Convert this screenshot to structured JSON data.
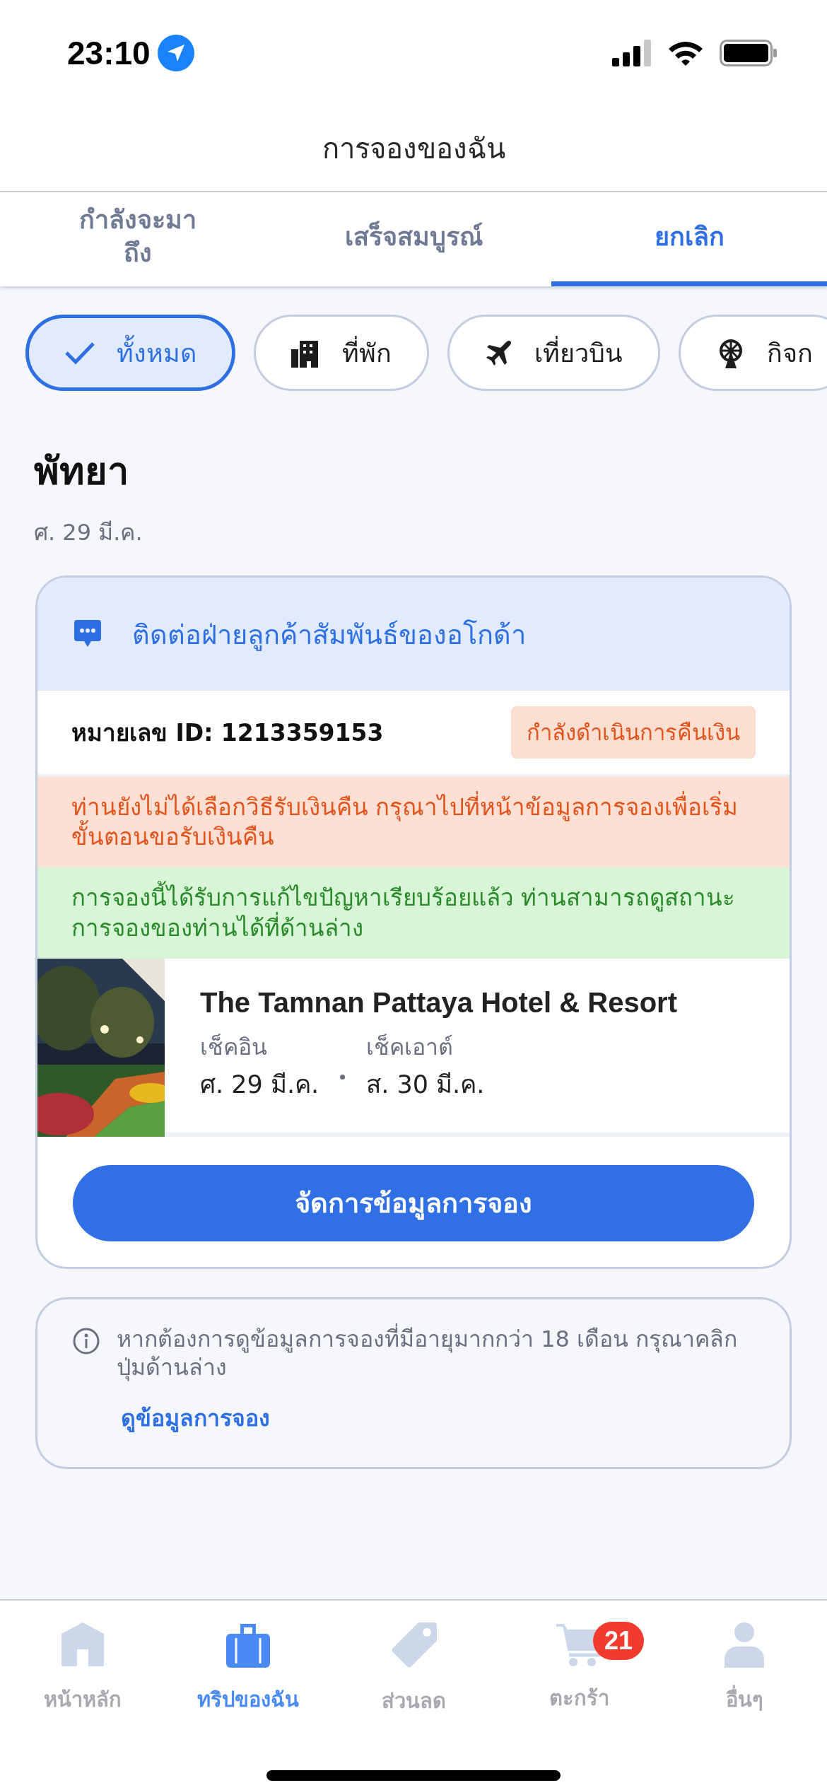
{
  "status_bar": {
    "time": "23:10"
  },
  "header": {
    "title": "การจองของฉัน"
  },
  "tabs": [
    {
      "label": "กำลังจะมาถึง",
      "selected": false
    },
    {
      "label": "เสร็จสมบูรณ์",
      "selected": false
    },
    {
      "label": "ยกเลิก",
      "selected": true
    }
  ],
  "filters": [
    {
      "label": "ทั้งหมด",
      "kind": "all",
      "selected": true
    },
    {
      "label": "ที่พัก",
      "kind": "stay",
      "selected": false
    },
    {
      "label": "เที่ยวบิน",
      "kind": "flight",
      "selected": false
    },
    {
      "label": "กิจก",
      "kind": "activity",
      "selected": false
    }
  ],
  "booking": {
    "city": "พัทยา",
    "date": "ศ. 29 มี.ค.",
    "contact_link": "ติดต่อฝ่ายลูกค้าสัมพันธ์ของอโกด้า",
    "booking_id": "หมายเลข ID: 1213359153",
    "status_badge": "กำลังดำเนินการคืนเงิน",
    "alerts": [
      {
        "kind": "warning",
        "text": "ท่านยังไม่ได้เลือกวิธีรับเงินคืน กรุณาไปที่หน้าข้อมูลการจองเพื่อเริ่มขั้นตอนขอรับเงินคืน"
      },
      {
        "kind": "success",
        "text": "การจองนี้ได้รับการแก้ไขปัญหาเรียบร้อยแล้ว ท่านสามารถดูสถานะการจองของท่านได้ที่ด้านล่าง"
      }
    ],
    "hotel": {
      "name": "The Tamnan Pattaya Hotel & Resort",
      "checkin_label": "เช็คอิน",
      "checkin_date": "ศ. 29 มี.ค.",
      "checkout_label": "เช็คเอาต์",
      "checkout_date": "ส. 30 มี.ค."
    },
    "manage_button": "จัดการข้อมูลการจอง"
  },
  "notice": {
    "text": "หากต้องการดูข้อมูลการจองที่มีอายุมากกว่า 18 เดือน กรุณาคลิกปุ่มด้านล่าง",
    "link": "ดูข้อมูลการจอง"
  },
  "bottom_nav": [
    {
      "label": "หน้าหลัก",
      "kind": "home",
      "selected": false
    },
    {
      "label": "ทริปของฉัน",
      "kind": "trips",
      "selected": true
    },
    {
      "label": "ส่วนลด",
      "kind": "deals",
      "selected": false
    },
    {
      "label": "ตะกร้า",
      "kind": "cart",
      "selected": false,
      "badge": "21"
    },
    {
      "label": "อื่นๆ",
      "kind": "more",
      "selected": false
    }
  ]
}
